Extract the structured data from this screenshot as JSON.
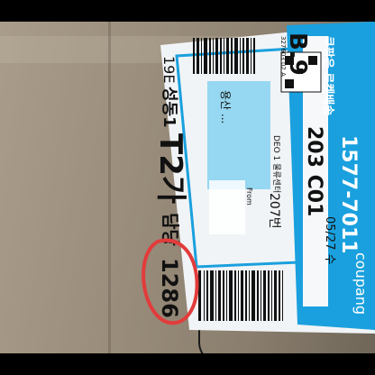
{
  "photo": {
    "subject": "parcel-shipping-label",
    "colors": {
      "cardboard": "#9b8e7c",
      "label_white": "#f3f6f8",
      "label_blue": "#1aa0de",
      "mark_red": "#e23b3b",
      "blur": "#7fd0f0"
    }
  },
  "label": {
    "hub_code": "B.9",
    "brand": "쿠팡은 로켓배송",
    "brand_en": "coupang",
    "phone": "1577-7011",
    "route": "203 C01",
    "center": "DEO 1 물류센터",
    "date": "05/27 수",
    "zone_code": "19E",
    "area": "성동1",
    "section": "T2가",
    "unit": "207번",
    "small_code": "327603 02 A",
    "partial_address": "용산 ...",
    "from_label": "From",
    "delivery_label": "담당",
    "delivery_number": "1286"
  }
}
